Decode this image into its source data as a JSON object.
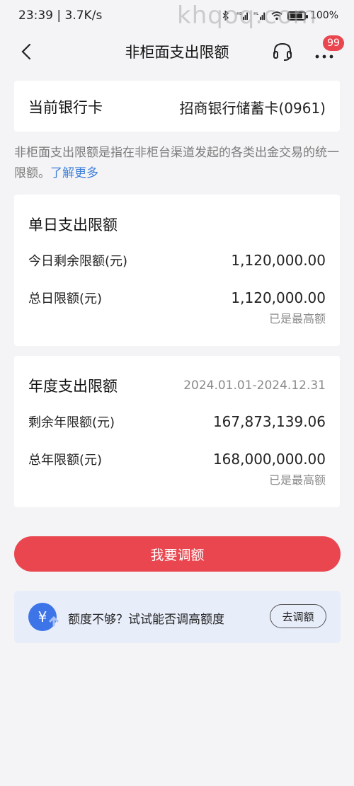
{
  "status_bar": {
    "time_speed": "23:39 | 3.7K/s",
    "battery": "100%",
    "battery_level": 1.0,
    "watermark": "khqoq.com"
  },
  "nav": {
    "title": "非柜面支出限额",
    "badge": "99"
  },
  "card": {
    "label": "当前银行卡",
    "value": "招商银行储蓄卡(0961)"
  },
  "description": {
    "text": "非柜面支出限额是指在非柜台渠道发起的各类出金交易的统一限额。",
    "link": "了解更多"
  },
  "daily": {
    "title": "单日支出限额",
    "remaining_label": "今日剩余限额(元)",
    "remaining_value": "1,120,000.00",
    "total_label": "总日限额(元)",
    "total_value": "1,120,000.00",
    "note": "已是最高额"
  },
  "annual": {
    "title": "年度支出限额",
    "period": "2024.01.01-2024.12.31",
    "remaining_label": "剩余年限额(元)",
    "remaining_value": "167,873,139.06",
    "total_label": "总年限额(元)",
    "total_value": "168,000,000.00",
    "note": "已是最高额"
  },
  "cta": {
    "label": "我要调额"
  },
  "promo": {
    "icon_symbol": "¥",
    "text": "额度不够？试试能否调高额度",
    "button": "去调额"
  },
  "colors": {
    "accent_red": "#e9464f",
    "link_blue": "#3f7fd9",
    "promo_bg": "#e8edfa",
    "promo_icon": "#3d74e8"
  }
}
